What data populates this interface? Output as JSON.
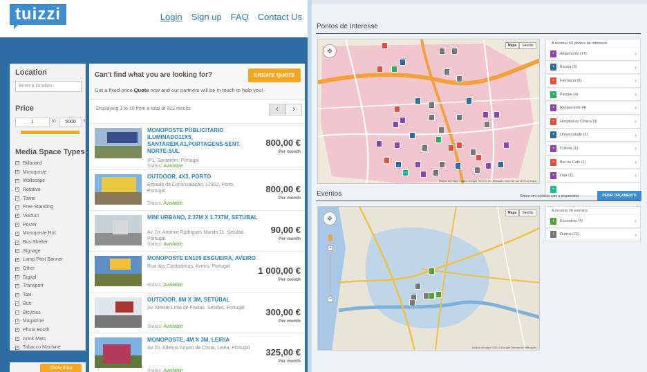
{
  "header": {
    "logo": "tuizzi",
    "nav": [
      {
        "label": "Login"
      },
      {
        "label": "Sign up"
      },
      {
        "label": "FAQ"
      },
      {
        "label": "Contact Us"
      }
    ]
  },
  "filters": {
    "location_title": "Location",
    "location_placeholder": "Enter a location",
    "price_title": "Price",
    "price_min": "1",
    "price_to": "to",
    "price_max": "5000",
    "price_currency": "€",
    "media_title": "Media Space Types",
    "media_types": [
      "Billboard",
      "Monoposte",
      "Wallscape",
      "Rotativo",
      "Tower",
      "Free Standing",
      "Viaduct",
      "Poster",
      "Monoposte Rot.",
      "Bus Shelter",
      "Signage",
      "Lamp Post Banner",
      "Other",
      "Digital",
      "Transport",
      "Taxi",
      "Bus",
      "Bicycles",
      "Magazine",
      "Photo Booth",
      "Drink Mats",
      "Tabacco Machine"
    ],
    "show_button": "Show map"
  },
  "cta": {
    "title": "Can't find what you are looking for?",
    "text_before": "Get a fixed price ",
    "text_bold": "Quote",
    "text_after": " now and our partners will be in touch to help you!",
    "button": "CREATE QUOTE"
  },
  "results": {
    "count_text": "Displaying 1 to 10 from a total of 922 results",
    "prev": "‹",
    "next": "›",
    "per": "Per month",
    "status_label": "Status:",
    "items": [
      {
        "title": "MONOPOSTE PUBLICITARIO ILUMINADO11X5, SANTARÉM,A1,PORTAGENS-SENT. NORTE-SUL",
        "address": "IP1, Santarém, Portugal",
        "status": "Available",
        "price": "800,00 €"
      },
      {
        "title": "OUTDOOR, 4X3, PORTO",
        "address": "Estrada da Circunvalação, 12322, Porto, Portugal",
        "status": "Available",
        "price": "800,00 €"
      },
      {
        "title": "MINI URBANO, 2.37M X 1.737M, SETÚBAL",
        "address": "Av. Dr. António Rodrigues Manito 11, Setúbal, Portugal",
        "status": "Available",
        "price": "90,00 €"
      },
      {
        "title": "MONOPOSTE EN109 ESGUEIRA, AVEIRO",
        "address": "Rua das Cardadeiras, Aveiro, Portugal",
        "status": "Available",
        "price": "1 000,00 €"
      },
      {
        "title": "OUTDOOR, 8M X 3M, SETÚBAL",
        "address": "Av. Mestre Lima de Freitas, Setúbal, Portugal",
        "status": "Available",
        "price": "300,00 €"
      },
      {
        "title": "MONOPOSTE, 4M X 3M, LEIRIA",
        "address": "Av. Dr. Adelino Amaro da Costa, Leiria, Portugal",
        "status": "Available",
        "price": "325,00 €"
      }
    ]
  },
  "poi": {
    "section_title": "Pontos de Interesse",
    "map_type": [
      "Mapa",
      "Satélite"
    ],
    "map_footer": "Dados do mapa ©2014 Google   Termos de Utilização   Informar um erro no mapa",
    "list_header": "A mostrar 60 pontos de interesse",
    "items": [
      {
        "label": "Alojamento (17)",
        "color": "#8e44ad",
        "icon": "bed-icon"
      },
      {
        "label": "Escola (5)",
        "color": "#2e6da4",
        "icon": "school-icon"
      },
      {
        "label": "Farmácia (6)",
        "color": "#e74c3c",
        "icon": "pharmacy-icon"
      },
      {
        "label": "Parque (4)",
        "color": "#27ae60",
        "icon": "park-icon"
      },
      {
        "label": "Restaurante (4)",
        "color": "#8e44ad",
        "icon": "restaurant-icon"
      },
      {
        "label": "Hospital ou Clínica (3)",
        "color": "#e74c3c",
        "icon": "hospital-icon"
      },
      {
        "label": "Universidade (2)",
        "color": "#2e6da4",
        "icon": "university-icon"
      },
      {
        "label": "Cultura (1)",
        "color": "#8e44ad",
        "icon": "culture-icon"
      },
      {
        "label": "Bar ou Café (1)",
        "color": "#e74c3c",
        "icon": "bar-icon"
      },
      {
        "label": "Loja (1)",
        "color": "#8e44ad",
        "icon": "shop-icon"
      },
      {
        "label": "",
        "color": "#1abc9c",
        "icon": "misc-icon"
      }
    ]
  },
  "events": {
    "section_title": "Eventos",
    "contact_text": "Entrar em contacto com o proprietário:",
    "contact_button": "PEDIR ORÇAMENTO",
    "map_type": [
      "Mapa",
      "Satélite"
    ],
    "map_footer": "Dados do mapa ©2014 Google   Termos de Utilização",
    "list_header": "A mostrar 26 eventos",
    "items": [
      {
        "label": "Encontros (4)",
        "color": "#5aa02c",
        "icon": "meeting-icon"
      },
      {
        "label": "Outros (22)",
        "color": "#777777",
        "icon": "info-icon"
      }
    ]
  }
}
